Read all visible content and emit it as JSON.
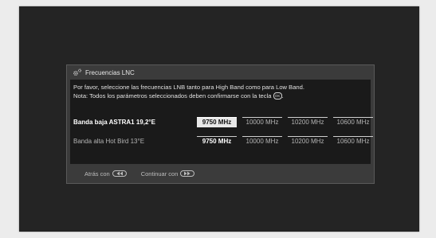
{
  "dialog": {
    "title": "Frecuencias LNC",
    "icon": "gear-icon",
    "intro_line1": "Por favor, seleccione las frecuencias LNB tanto para High Band como para Low Band.",
    "intro_line2_text": "Nota: Todos los parámetros seleccionados deben confirmarse con la tecla",
    "intro_line2_end": ".",
    "ok_key_label": "OK"
  },
  "rows": [
    {
      "label": "Banda baja ASTRA1 19,2°E",
      "options": [
        "9750 MHz",
        "10000 MHz",
        "10200 MHz",
        "10600 MHz"
      ],
      "selected_index": 0,
      "focused": true
    },
    {
      "label": "Banda alta Hot Bird 13°E",
      "options": [
        "9750 MHz",
        "10000 MHz",
        "10200 MHz",
        "10600 MHz"
      ],
      "selected_index": 0,
      "focused": false
    }
  ],
  "footer": {
    "back_label": "Atrás con",
    "back_icon": "rewind-key-icon",
    "next_label": "Continuar con",
    "next_icon": "forward-key-icon"
  },
  "colors": {
    "background": "#242424",
    "dialog_frame": "#3b3b3b",
    "dialog_body": "#1a1a1a",
    "selected_focus": "#e8e8e8"
  }
}
